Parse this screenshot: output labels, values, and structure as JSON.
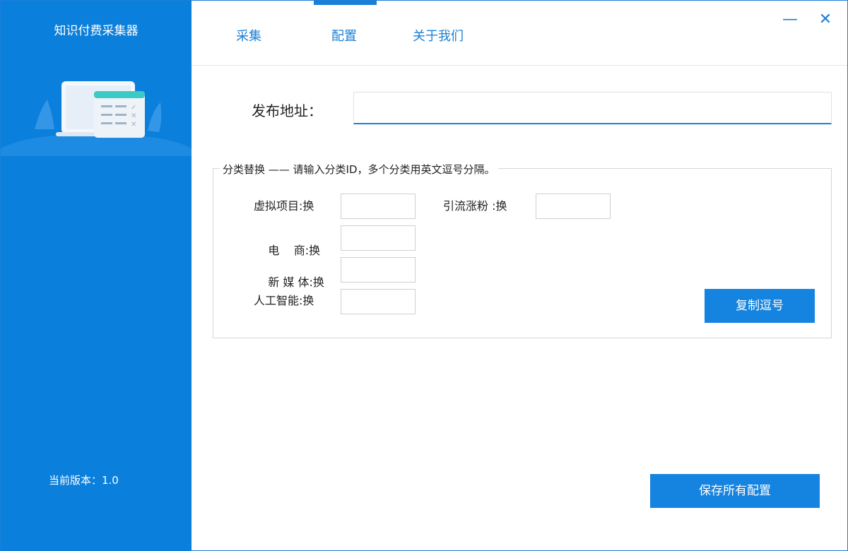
{
  "app": {
    "title": "知识付费采集器",
    "version_text": "当前版本：1.0"
  },
  "tabs": [
    {
      "label": "采集"
    },
    {
      "label": "配置"
    },
    {
      "label": "关于我们"
    }
  ],
  "active_tab": "配置",
  "window_controls": {
    "minimize": "—",
    "close": "✕"
  },
  "publish": {
    "label": "发布地址：",
    "value": ""
  },
  "category": {
    "legend": "分类替换 —— 请输入分类ID，多个分类用英文逗号分隔。",
    "fields": [
      {
        "label": "虚拟项目",
        "suffix": ":换",
        "value": ""
      },
      {
        "label": "电    商",
        "suffix": ":换",
        "value": ""
      },
      {
        "label": "新 媒 体",
        "suffix": ":换",
        "value": ""
      },
      {
        "label": "人工智能",
        "suffix": ":换",
        "value": ""
      },
      {
        "label": "引流涨粉",
        "suffix": ":换",
        "value": ""
      }
    ],
    "copy_button": "复制逗号"
  },
  "save_button": "保存所有配置",
  "colors": {
    "sidebar": "#0b7fdc",
    "accent": "#1a7fd6",
    "button": "#1584e0"
  }
}
